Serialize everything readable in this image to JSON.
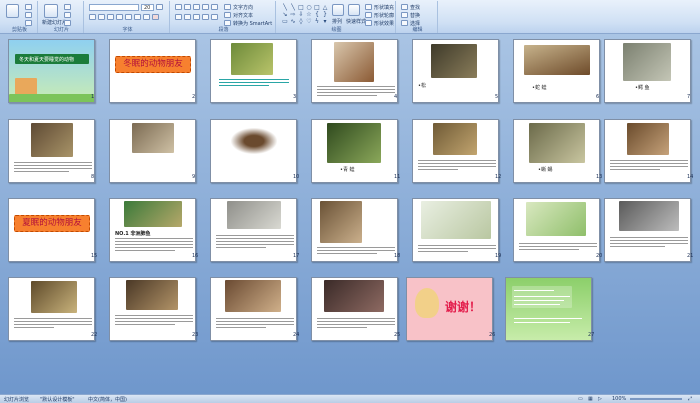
{
  "ribbon": {
    "groups": [
      {
        "label": "剪贴板",
        "buttons": [
          "粘贴",
          "剪切",
          "复制",
          "格式刷"
        ]
      },
      {
        "label": "字体",
        "font_name": "",
        "font_size": "20",
        "buttons": [
          "加粗",
          "倾斜",
          "下划线",
          "删除线",
          "字体颜色"
        ]
      },
      {
        "label": "段落",
        "buttons": [
          "文字方向",
          "对齐文本",
          "转换为 SmartArt"
        ]
      },
      {
        "label": "绘图",
        "buttons": [
          "排列",
          "快速样式",
          "形状填充",
          "形状轮廓",
          "形状效果"
        ]
      },
      {
        "label": "编辑",
        "buttons": [
          "查找",
          "替换",
          "选择"
        ]
      }
    ],
    "slides_group": {
      "label": "幻灯片",
      "buttons": [
        "新建幻灯片",
        "版式",
        "重设",
        "删除"
      ]
    }
  },
  "slides": [
    {
      "num": "1",
      "title": "冬天和夏天要睡觉的动物"
    },
    {
      "num": "2",
      "title": "冬眠的动物朋友"
    },
    {
      "num": "3",
      "caption": ""
    },
    {
      "num": "4",
      "caption": ""
    },
    {
      "num": "5",
      "caption": "•松"
    },
    {
      "num": "6",
      "caption": "•蛇  蛙"
    },
    {
      "num": "7",
      "caption": "•鳄  鱼"
    },
    {
      "num": "8",
      "caption": ""
    },
    {
      "num": "9",
      "caption": ""
    },
    {
      "num": "10",
      "caption": ""
    },
    {
      "num": "11",
      "caption": "•青  蛙"
    },
    {
      "num": "12",
      "caption": ""
    },
    {
      "num": "13",
      "caption": "•蜥  蜴"
    },
    {
      "num": "14",
      "caption": ""
    },
    {
      "num": "15",
      "title": "夏眠的动物朋友"
    },
    {
      "num": "16",
      "caption": "NO.1  非洲肺鱼"
    },
    {
      "num": "17",
      "caption": ""
    },
    {
      "num": "18",
      "caption": ""
    },
    {
      "num": "19",
      "caption": ""
    },
    {
      "num": "20",
      "caption": ""
    },
    {
      "num": "21",
      "caption": ""
    },
    {
      "num": "22",
      "caption": ""
    },
    {
      "num": "23",
      "caption": ""
    },
    {
      "num": "24",
      "caption": ""
    },
    {
      "num": "25",
      "caption": ""
    },
    {
      "num": "26",
      "title": "谢谢！"
    },
    {
      "num": "27",
      "caption": ""
    }
  ],
  "status": {
    "slide_view": "幻灯片浏览",
    "theme": "\"默认设计模板\"",
    "language": "中文(简体，中国)",
    "zoom": "100%"
  }
}
